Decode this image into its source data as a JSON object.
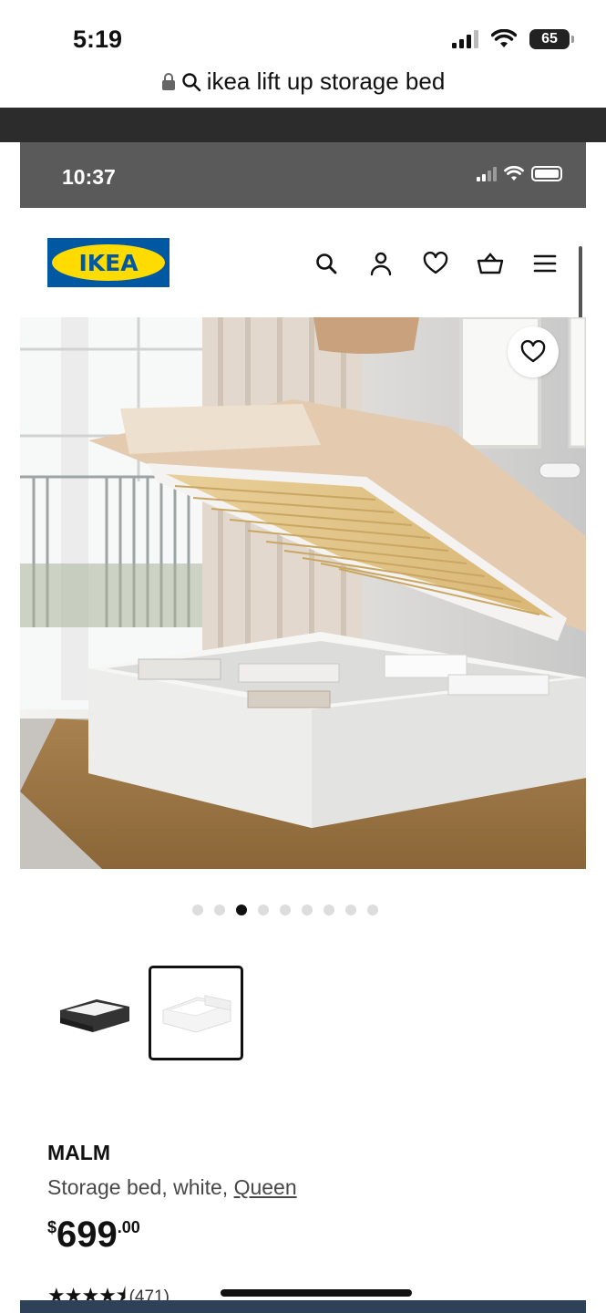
{
  "outer_status": {
    "time": "5:19",
    "battery": "65"
  },
  "browser": {
    "url_text": "ikea lift up storage bed"
  },
  "inner_status": {
    "time": "10:37"
  },
  "header": {
    "logo_text": "IKEA"
  },
  "colors": {
    "ikea_blue": "#0058a3",
    "ikea_yellow": "#ffdb00"
  },
  "gallery": {
    "dot_count": 9,
    "active_dot": 3
  },
  "product": {
    "name": "MALM",
    "description": "Storage bed, white,",
    "size_link": "Queen",
    "price_currency": "$",
    "price_whole": "699",
    "price_cents": ".00",
    "rating_count": "(471)",
    "rating_value": 4.5
  }
}
